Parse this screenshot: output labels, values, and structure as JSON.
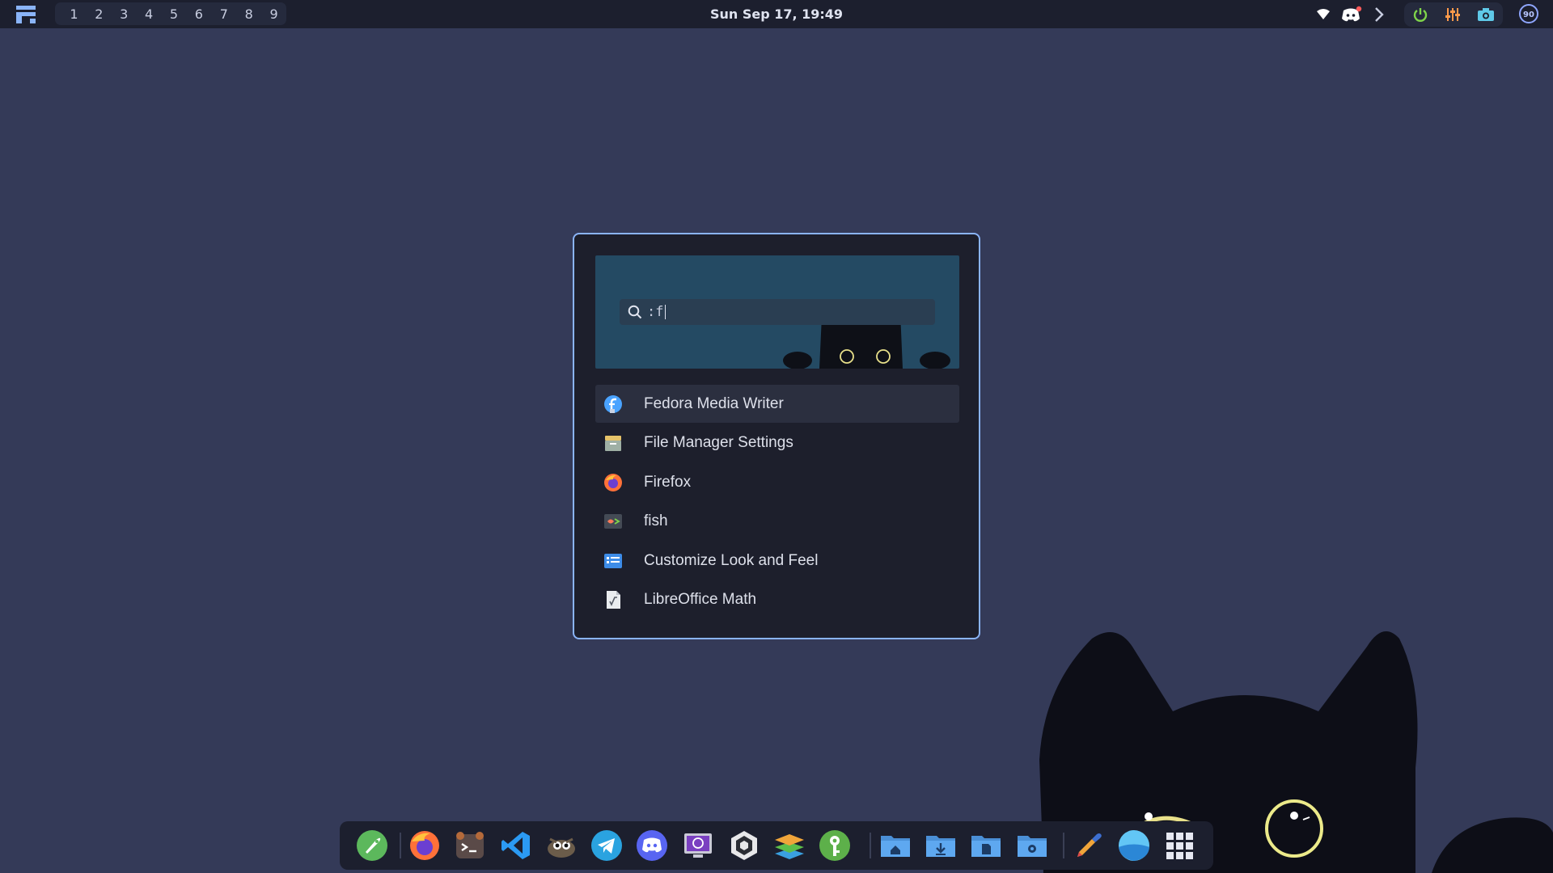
{
  "topbar": {
    "workspaces": [
      "1",
      "2",
      "3",
      "4",
      "5",
      "6",
      "7",
      "8",
      "9"
    ],
    "clock": "Sun Sep 17, 19:49",
    "tray_icons": [
      "wifi-icon",
      "discord-tray-icon",
      "chevron-right-icon",
      "power-icon",
      "equalizer-icon",
      "camera-icon"
    ],
    "battery": "90"
  },
  "launcher": {
    "search": {
      "prefix": ":",
      "query": "f"
    },
    "results": [
      {
        "label": "Fedora Media Writer",
        "icon": "fedora-media-writer-icon",
        "selected": true
      },
      {
        "label": "File Manager Settings",
        "icon": "file-manager-settings-icon",
        "selected": false
      },
      {
        "label": "Firefox",
        "icon": "firefox-icon",
        "selected": false
      },
      {
        "label": "fish",
        "icon": "fish-terminal-icon",
        "selected": false
      },
      {
        "label": "Customize Look and Feel",
        "icon": "look-and-feel-icon",
        "selected": false
      },
      {
        "label": "LibreOffice Math",
        "icon": "libreoffice-math-icon",
        "selected": false
      }
    ]
  },
  "dock": {
    "apps": [
      "rocket-launcher-icon",
      "firefox-icon",
      "terminal-icon",
      "vscode-icon",
      "gimp-icon",
      "telegram-icon",
      "discord-icon",
      "virtual-machine-icon",
      "unity-icon",
      "layers-icon",
      "keepass-icon",
      "home-folder-icon",
      "downloads-folder-icon",
      "documents-folder-icon",
      "settings-folder-icon",
      "color-picker-icon",
      "weather-icon",
      "app-grid-icon"
    ]
  },
  "colors": {
    "background": "#343a58",
    "bar": "#1c1f2e",
    "accent": "#8ab4f8",
    "banner": "#244a63"
  }
}
